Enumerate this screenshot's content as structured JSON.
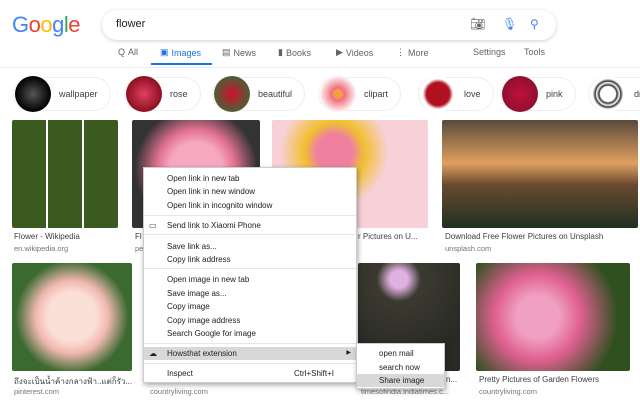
{
  "header": {
    "logo": "Google",
    "query": "flower"
  },
  "icons": {
    "camera": "camera-icon",
    "mic": "microphone-icon",
    "search": "search-icon"
  },
  "tabs": [
    {
      "label": "All",
      "icon": "Q"
    },
    {
      "label": "Images",
      "icon": "▣"
    },
    {
      "label": "News",
      "icon": "▤"
    },
    {
      "label": "Books",
      "icon": "▮"
    },
    {
      "label": "Videos",
      "icon": "▶"
    },
    {
      "label": "More",
      "icon": "⋮"
    }
  ],
  "tools": {
    "settings": "Settings",
    "tools": "Tools"
  },
  "chips": [
    "wallpaper",
    "rose",
    "beautiful",
    "clipart",
    "love",
    "pink",
    "dr"
  ],
  "results": [
    {
      "caption": "Flower - Wikipedia",
      "source": "en.wikipedia.org"
    },
    {
      "caption": "Fl",
      "source": "pe"
    },
    {
      "caption": "r Pictures on U...",
      "source": ""
    },
    {
      "caption": "Download Free Flower Pictures on Unsplash",
      "source": "unsplash.com"
    },
    {
      "caption": "ถึงจะเป็นน้ำค้างกลางฟ้า..แต่ก็รัว...",
      "source": "pinterest.com"
    },
    {
      "caption": "",
      "source": "countryliving.com"
    },
    {
      "caption": "n...",
      "source": "timesofindia.indiatimes.c..."
    },
    {
      "caption": "Pretty Pictures of Garden Flowers",
      "source": "countryliving.com"
    }
  ],
  "context_menu": {
    "items": [
      "Open link in new tab",
      "Open link in new window",
      "Open link in incognito window",
      "Send link to Xiaomi Phone",
      "Save link as...",
      "Copy link address",
      "Open image in new tab",
      "Save image as...",
      "Copy image",
      "Copy image address",
      "Search Google for image",
      "Howsthat extension",
      "Inspect"
    ],
    "inspect_shortcut": "Ctrl+Shift+I",
    "submenu": [
      "open mail",
      "search now",
      "Share image"
    ]
  }
}
